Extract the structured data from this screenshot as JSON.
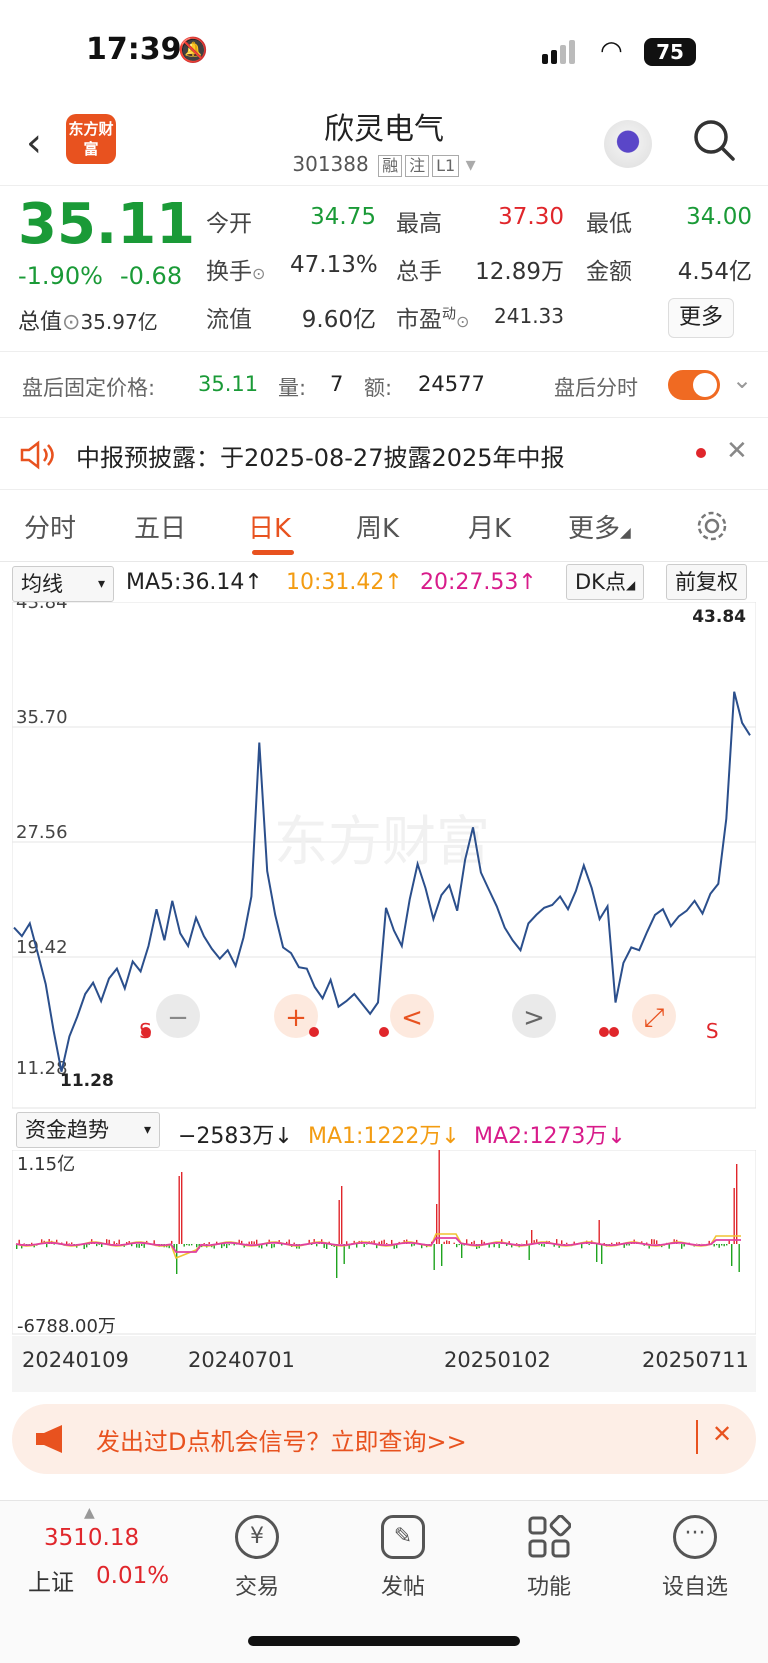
{
  "status_bar": {
    "time": "17:39",
    "battery": "75"
  },
  "header": {
    "logo_text": "东方财富",
    "title": "欣灵电气",
    "code": "301388",
    "tags": [
      "融",
      "注",
      "L1"
    ]
  },
  "quote": {
    "price": "35.11",
    "change_pct": "-1.90%",
    "change": "-0.68",
    "total_value_label": "总值",
    "total_value": "35.97亿",
    "fields": [
      {
        "label": "今开",
        "value": "34.75",
        "color": "green"
      },
      {
        "label": "最高",
        "value": "37.30",
        "color": "red"
      },
      {
        "label": "最低",
        "value": "34.00",
        "color": "green"
      },
      {
        "label": "换手",
        "value": "47.13%",
        "color": "dark"
      },
      {
        "label": "总手",
        "value": "12.89万",
        "color": "dark"
      },
      {
        "label": "金额",
        "value": "4.54亿",
        "color": "dark"
      },
      {
        "label": "流值",
        "value": "9.60亿",
        "color": "dark"
      },
      {
        "label": "市盈",
        "label_sup": "动",
        "value": "241.33",
        "color": "dark"
      }
    ],
    "more_label": "更多"
  },
  "after_hours": {
    "label": "盘后固定价格:",
    "price": "35.11",
    "vol_label": "量:",
    "vol": "7",
    "amt_label": "额:",
    "amt": "24577",
    "toggle_label": "盘后分时"
  },
  "notice": {
    "text": "中报预披露：于2025-08-27披露2025年中报"
  },
  "tabs": {
    "items": [
      "分时",
      "五日",
      "日K",
      "周K",
      "月K",
      "更多"
    ],
    "active": "日K"
  },
  "ma_line": {
    "select": "均线",
    "ma5": "MA5:36.14↑",
    "ma10": "10:31.42↑",
    "ma20": "20:27.53↑",
    "dk": "DK点",
    "adjust": "前复权"
  },
  "chart_data": {
    "type": "line",
    "y_ticks": [
      "43.84",
      "35.70",
      "27.56",
      "19.42",
      "11.28"
    ],
    "ylim": [
      11.28,
      43.84
    ],
    "max_label": "43.84",
    "min_label": "11.28",
    "watermark": "东方财富",
    "values": [
      21.5,
      20.9,
      21.8,
      19.7,
      17.5,
      14.2,
      11.3,
      13.8,
      15.2,
      16.8,
      17.6,
      16.3,
      17.9,
      18.6,
      17.2,
      19.1,
      18.4,
      20.2,
      22.8,
      20.6,
      23.4,
      21.1,
      20.2,
      22.2,
      20.9,
      20.0,
      19.3,
      19.9,
      18.8,
      20.8,
      23.7,
      34.6,
      25.5,
      22.4,
      20.1,
      19.7,
      18.7,
      18.6,
      17.3,
      16.5,
      17.8,
      15.9,
      16.3,
      16.8,
      16.1,
      15.4,
      16.2,
      22.9,
      21.3,
      20.2,
      23.5,
      26.0,
      24.3,
      22.1,
      23.8,
      24.5,
      22.7,
      26.3,
      28.6,
      25.4,
      24.2,
      23.0,
      21.5,
      20.6,
      19.9,
      21.8,
      22.4,
      22.9,
      23.1,
      23.7,
      22.8,
      24.1,
      25.9,
      24.3,
      22.1,
      23.0,
      16.2,
      19.0,
      20.1,
      19.9,
      21.2,
      22.4,
      22.8,
      21.6,
      22.3,
      22.7,
      23.4,
      22.5,
      23.9,
      24.6,
      29.2,
      38.2,
      36.0,
      35.11
    ],
    "markers": [
      {
        "x": 0.17,
        "label": "S"
      },
      {
        "x": 0.94,
        "label": "S"
      }
    ],
    "nav_buttons": [
      "−",
      "+",
      "<",
      ">",
      "⤢"
    ]
  },
  "fund_trend": {
    "select": "资金趋势",
    "value": "−2583万↓",
    "ma1": "MA1:1222万↓",
    "ma2": "MA2:1273万↓",
    "y_top": "1.15亿",
    "y_bottom": "-6788.00万",
    "dates": [
      "20240109",
      "20240701",
      "20250102",
      "20250711"
    ]
  },
  "promo": {
    "text": "发出过D点机会信号？立即查询>>",
    "icon": "megaphone-icon"
  },
  "dock": {
    "index_value": "3510.18",
    "index_name": "上证",
    "index_change": "0.01%",
    "items": [
      {
        "label": "交易",
        "icon": "yen-icon"
      },
      {
        "label": "发帖",
        "icon": "edit-icon"
      },
      {
        "label": "功能",
        "icon": "grid-icon"
      },
      {
        "label": "设自选",
        "icon": "more-icon"
      }
    ]
  },
  "colors": {
    "up": "#e0262b",
    "down": "#1a9a37",
    "accent": "#e8521f",
    "line": "#2b4f8c",
    "ma10": "#f39c12",
    "ma20": "#d81b8a"
  }
}
